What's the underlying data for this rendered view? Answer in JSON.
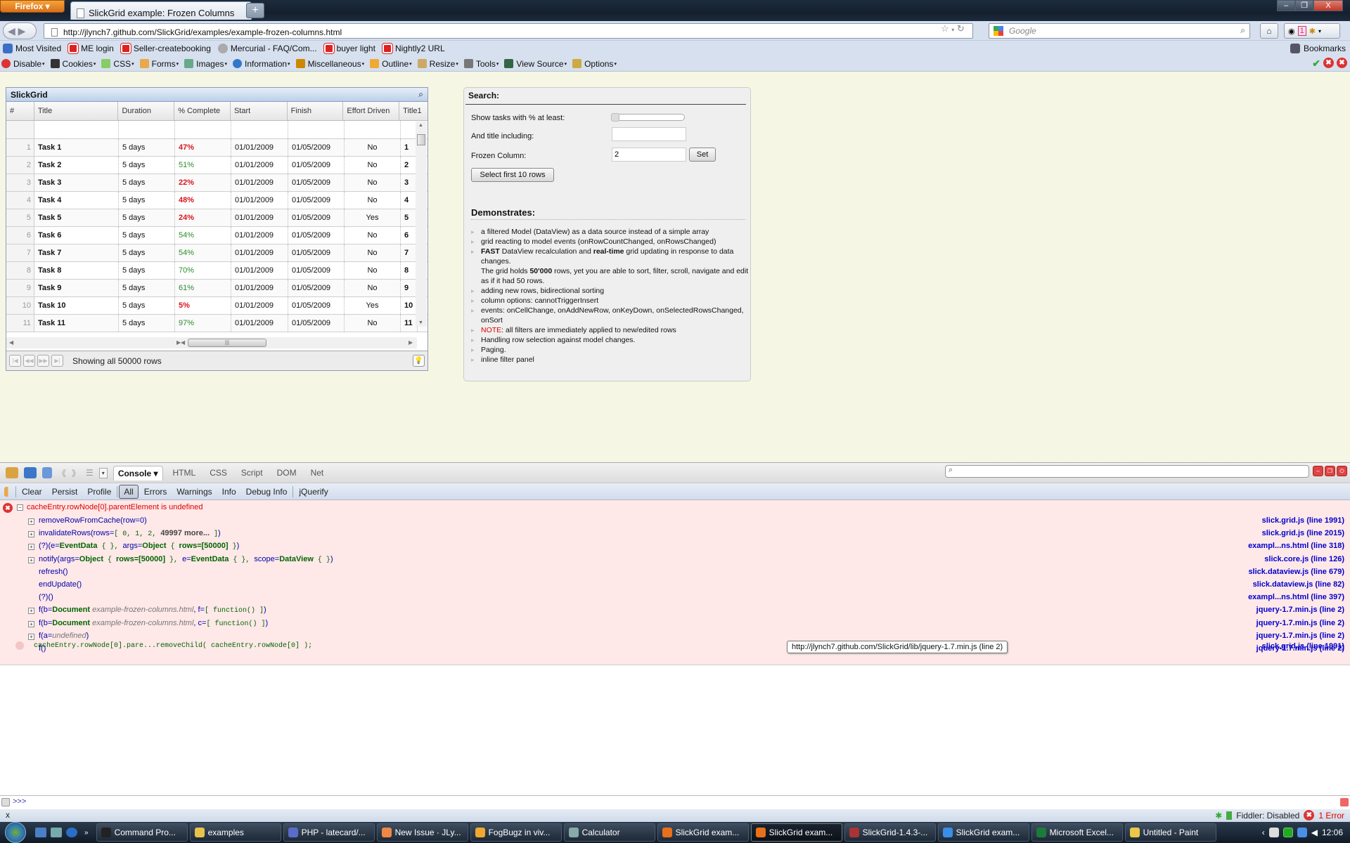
{
  "browser": {
    "app_button": "Firefox",
    "tab_title": "SlickGrid example: Frozen Columns",
    "new_tab": "+",
    "url": "http://jlynch7.github.com/SlickGrid/examples/example-frozen-columns.html",
    "search_placeholder": "Google",
    "addon_badge": "1"
  },
  "bookmarks": {
    "items": [
      {
        "label": "Most Visited",
        "icon": "most-visited-icon"
      },
      {
        "label": "ME login",
        "icon": "bookmark-red-icon"
      },
      {
        "label": "Seller-createbooking",
        "icon": "bookmark-red-icon"
      },
      {
        "label": "Mercurial - FAQ/Com...",
        "icon": "mercurial-icon"
      },
      {
        "label": "buyer light",
        "icon": "bookmark-red-icon"
      },
      {
        "label": "Nightly2 URL",
        "icon": "bookmark-red-icon"
      }
    ],
    "right_label": "Bookmarks"
  },
  "webdev_toolbar": {
    "items": [
      {
        "label": "Disable",
        "color": "#d33"
      },
      {
        "label": "Cookies",
        "color": "#333"
      },
      {
        "label": "CSS",
        "color": "#8c6"
      },
      {
        "label": "Forms",
        "color": "#e9a84a"
      },
      {
        "label": "Images",
        "color": "#6a8"
      },
      {
        "label": "Information",
        "color": "#37c"
      },
      {
        "label": "Miscellaneous",
        "color": "#c80"
      },
      {
        "label": "Outline",
        "color": "#ea3"
      },
      {
        "label": "Resize",
        "color": "#ca6"
      },
      {
        "label": "Tools",
        "color": "#777"
      },
      {
        "label": "View Source",
        "color": "#364"
      },
      {
        "label": "Options",
        "color": "#ca4"
      }
    ]
  },
  "grid": {
    "title": "SlickGrid",
    "columns": [
      "#",
      "Title",
      "Duration",
      "% Complete",
      "Start",
      "Finish",
      "Effort Driven",
      "Title1"
    ],
    "rows": [
      {
        "num": "1",
        "title": "Task 1",
        "duration": "5 days",
        "pct": "47%",
        "pct_status": "red",
        "start": "01/01/2009",
        "finish": "01/05/2009",
        "effort": "No",
        "title1": "1"
      },
      {
        "num": "2",
        "title": "Task 2",
        "duration": "5 days",
        "pct": "51%",
        "pct_status": "green",
        "start": "01/01/2009",
        "finish": "01/05/2009",
        "effort": "No",
        "title1": "2"
      },
      {
        "num": "3",
        "title": "Task 3",
        "duration": "5 days",
        "pct": "22%",
        "pct_status": "red",
        "start": "01/01/2009",
        "finish": "01/05/2009",
        "effort": "No",
        "title1": "3"
      },
      {
        "num": "4",
        "title": "Task 4",
        "duration": "5 days",
        "pct": "48%",
        "pct_status": "red",
        "start": "01/01/2009",
        "finish": "01/05/2009",
        "effort": "No",
        "title1": "4"
      },
      {
        "num": "5",
        "title": "Task 5",
        "duration": "5 days",
        "pct": "24%",
        "pct_status": "red",
        "start": "01/01/2009",
        "finish": "01/05/2009",
        "effort": "Yes",
        "title1": "5"
      },
      {
        "num": "6",
        "title": "Task 6",
        "duration": "5 days",
        "pct": "54%",
        "pct_status": "green",
        "start": "01/01/2009",
        "finish": "01/05/2009",
        "effort": "No",
        "title1": "6"
      },
      {
        "num": "7",
        "title": "Task 7",
        "duration": "5 days",
        "pct": "54%",
        "pct_status": "green",
        "start": "01/01/2009",
        "finish": "01/05/2009",
        "effort": "No",
        "title1": "7"
      },
      {
        "num": "8",
        "title": "Task 8",
        "duration": "5 days",
        "pct": "70%",
        "pct_status": "green",
        "start": "01/01/2009",
        "finish": "01/05/2009",
        "effort": "No",
        "title1": "8"
      },
      {
        "num": "9",
        "title": "Task 9",
        "duration": "5 days",
        "pct": "61%",
        "pct_status": "green",
        "start": "01/01/2009",
        "finish": "01/05/2009",
        "effort": "No",
        "title1": "9"
      },
      {
        "num": "10",
        "title": "Task 10",
        "duration": "5 days",
        "pct": "5%",
        "pct_status": "red",
        "start": "01/01/2009",
        "finish": "01/05/2009",
        "effort": "Yes",
        "title1": "10"
      },
      {
        "num": "11",
        "title": "Task 11",
        "duration": "5 days",
        "pct": "97%",
        "pct_status": "green",
        "start": "01/01/2009",
        "finish": "01/05/2009",
        "effort": "No",
        "title1": "11"
      }
    ],
    "pager_status": "Showing all 50000 rows"
  },
  "options_panel": {
    "title": "Search:",
    "pct_label": "Show tasks with % at least:",
    "pct_slider_value": 0,
    "title_label": "And title including:",
    "title_value": "",
    "frozen_label": "Frozen Column:",
    "frozen_value": "2",
    "set_button": "Set",
    "select_button": "Select first 10 rows",
    "demonstrates_title": "Demonstrates:",
    "demonstrates": [
      {
        "html": "a filtered Model (DataView) as a data source instead of a simple array"
      },
      {
        "html": "grid reacting to model events (onRowCountChanged, onRowsChanged)"
      },
      {
        "html": "<b>FAST</b> DataView recalculation and <b>real-time</b> grid updating in response to data changes.<br>The grid holds <b>50'000</b> rows, yet you are able to sort, filter, scroll, navigate and edit as if it had 50 rows."
      },
      {
        "html": "adding new rows, bidirectional sorting"
      },
      {
        "html": "column options: cannotTriggerInsert"
      },
      {
        "html": "events: onCellChange, onAddNewRow, onKeyDown, onSelectedRowsChanged, onSort"
      },
      {
        "html": "<span class=\"note\">NOTE</span>: all filters are immediately applied to new/edited rows"
      },
      {
        "html": "Handling row selection against model changes."
      },
      {
        "html": "Paging."
      },
      {
        "html": "inline filter panel"
      }
    ]
  },
  "firebug": {
    "tabs": [
      "Console ▾",
      "HTML",
      "CSS",
      "Script",
      "DOM",
      "Net"
    ],
    "active_tab": 0,
    "console_buttons": [
      "Clear",
      "Persist",
      "Profile",
      "All",
      "Errors",
      "Warnings",
      "Info",
      "Debug Info",
      "jQuerify"
    ],
    "active_filter": "All",
    "error_message": "cacheEntry.rowNode[0].parentElement is undefined",
    "stack": [
      {
        "expandable": true,
        "html": "<span class=\"fn\">removeRowFromCache(row=0)</span>",
        "source": "slick.grid.js (line 1991)"
      },
      {
        "expandable": true,
        "html": "<span class=\"fn\">invalidateRows(rows=</span><span class=\"mono\">[ 0, 1, 2, </span><b style=\"color:#444\">49997 more...</b><span class=\"mono\"> ]</span><span class=\"fn\">)</span>",
        "source": "slick.grid.js (line 2015)"
      },
      {
        "expandable": true,
        "html": "<span class=\"fn\">(?)(e=</span><span class=\"obj\">EventData</span><span class=\"mono\"> {  }, </span><span class=\"fn\">args=</span><span class=\"obj\">Object</span><span class=\"mono\"> { </span><span class=\"obj\">rows=[50000]</span><span class=\"mono\"> }</span><span class=\"fn\">)</span>",
        "source": "exampl...ns.html (line 318)"
      },
      {
        "expandable": true,
        "html": "<span class=\"fn\">notify(args=</span><span class=\"obj\">Object</span><span class=\"mono\"> { </span><span class=\"obj\">rows=[50000]</span><span class=\"mono\"> }, </span><span class=\"fn\">e=</span><span class=\"obj\">EventData</span><span class=\"mono\"> {  }, </span><span class=\"fn\">scope=</span><span class=\"obj\">DataView</span><span class=\"mono\"> {  }</span><span class=\"fn\">)</span>",
        "source": "slick.core.js (line 126)"
      },
      {
        "expandable": false,
        "html": "<span class=\"fn\">refresh()</span>",
        "source": "slick.dataview.js (line 679)"
      },
      {
        "expandable": false,
        "html": "<span class=\"fn\">endUpdate()</span>",
        "source": "slick.dataview.js (line 82)"
      },
      {
        "expandable": false,
        "html": "<span class=\"fn\">(?)()</span>",
        "source": "exampl...ns.html (line 397)"
      },
      {
        "expandable": true,
        "html": "<span class=\"fn\">f(b=</span><span class=\"obj\">Document</span> <span class=\"ital\">example-frozen-columns.html</span><span class=\"fn\">, f=</span><span class=\"mono\">[ function() ]</span><span class=\"fn\">)</span>",
        "source": "jquery-1.7.min.js (line 2)"
      },
      {
        "expandable": true,
        "html": "<span class=\"fn\">f(b=</span><span class=\"obj\">Document</span> <span class=\"ital\">example-frozen-columns.html</span><span class=\"fn\">, c=</span><span class=\"mono\">[ function() ]</span><span class=\"fn\">)</span>",
        "source": "jquery-1.7.min.js (line 2)"
      },
      {
        "expandable": true,
        "html": "<span class=\"fn\">f(a=</span><span class=\"ital\">undefined</span><span class=\"fn\">)</span>",
        "source": "jquery-1.7.min.js (line 2)"
      },
      {
        "expandable": false,
        "html": "<span class=\"fn\">f()</span>",
        "source": "jquery-1.7.min.js (line 2)"
      }
    ],
    "source_line": "cacheEntry.rowNode[0].pare...removeChild( cacheEntry.rowNode[0] );",
    "source_line_link": "slick.grid.js (line 1991)",
    "tooltip": "http://jlynch7.github.com/SlickGrid/lib/jquery-1.7.min.js (line 2)",
    "command_prompt": ">>>"
  },
  "statusbar": {
    "close": "x",
    "fiddler": "Fiddler: Disabled",
    "errors": "1 Error"
  },
  "taskbar": {
    "tasks": [
      {
        "label": "Command Pro...",
        "color": "#222"
      },
      {
        "label": "examples",
        "color": "#e8c24a"
      },
      {
        "label": "PHP - latecard/...",
        "color": "#5a6cc8"
      },
      {
        "label": "New Issue · JLy...",
        "color": "#e84"
      },
      {
        "label": "FogBugz in viv...",
        "color": "#f0a830"
      },
      {
        "label": "Calculator",
        "color": "#8aa"
      },
      {
        "label": "SlickGrid exam...",
        "color": "#e8701a"
      },
      {
        "label": "SlickGrid exam...",
        "color": "#e8701a",
        "active": true
      },
      {
        "label": "SlickGrid-1.4.3-...",
        "color": "#a33"
      },
      {
        "label": "SlickGrid exam...",
        "color": "#3a8ee6"
      },
      {
        "label": "Microsoft Excel...",
        "color": "#1e7a3c"
      },
      {
        "label": "Untitled - Paint",
        "color": "#e9c84a"
      }
    ],
    "clock": "12:06"
  }
}
